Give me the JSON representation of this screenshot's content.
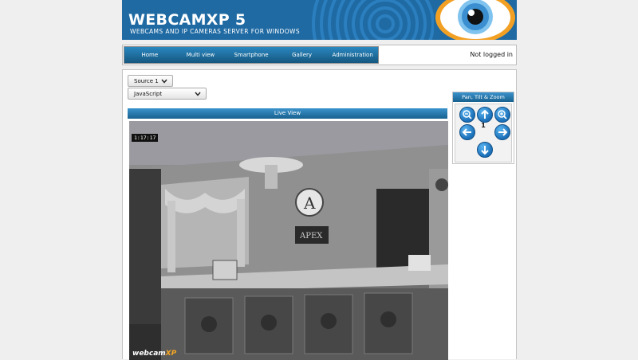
{
  "header": {
    "title": "WEBCAMXP 5",
    "subtitle": "WEBCAMS AND IP CAMERAS SERVER FOR WINDOWS",
    "bg_color": "#1f6aa3"
  },
  "nav": {
    "items": [
      "Home",
      "Multi view",
      "Smartphone",
      "Gallery",
      "Administration"
    ]
  },
  "login_status": "Not logged in",
  "controls": {
    "source_select": "Source 1",
    "mode_select": "JavaScript"
  },
  "live_view": {
    "title": "Live View",
    "timestamp": "1:17:17",
    "watermark_part1": "webcam",
    "watermark_part2": "XP"
  },
  "ptz": {
    "title": "Pan, Tilt & Zoom",
    "preset": "1",
    "icons": [
      "zoom-out-icon",
      "arrow-up-icon",
      "zoom-in-icon",
      "arrow-left-icon",
      "arrow-right-icon",
      "arrow-down-icon"
    ]
  }
}
